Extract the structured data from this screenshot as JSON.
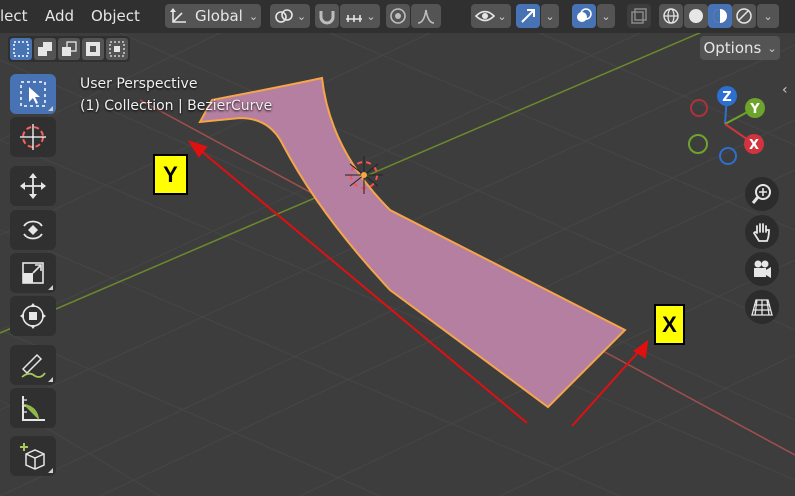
{
  "menu": {
    "select_label": "lect",
    "add_label": "Add",
    "object_label": "Object"
  },
  "transform": {
    "orientation_label": "Global"
  },
  "viewport": {
    "perspective_label": "User Perspective",
    "collection_label": "(1) Collection | BezierCurve",
    "options_label": "Options"
  },
  "gizmo": {
    "z": "Z",
    "y": "Y",
    "x": "X"
  },
  "annotations": {
    "y_label": "Y",
    "x_label": "X"
  },
  "colors": {
    "accent": "#4772b3",
    "curve_fill": "#b47fa0",
    "curve_outline": "#f5a54a",
    "arrow": "#e01010",
    "label_bg": "#ffff00",
    "x_axis": "#a04e4e",
    "y_axis": "#6b8a2c"
  }
}
